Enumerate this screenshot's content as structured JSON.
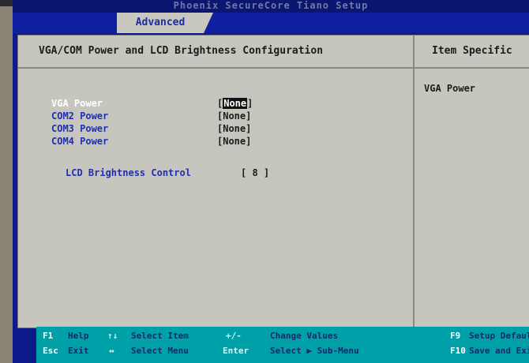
{
  "window": {
    "title": "Phoenix SecureCore Tiano Setup"
  },
  "tabs": [
    {
      "label": "Advanced"
    }
  ],
  "main": {
    "header": "VGA/COM Power and LCD Brightness Configuration",
    "items": [
      {
        "label": "VGA Power",
        "value_open": "[",
        "value": "None",
        "value_close": "]"
      },
      {
        "label": "COM2 Power",
        "value": "[None]"
      },
      {
        "label": "COM3 Power",
        "value": "[None]"
      },
      {
        "label": "COM4 Power",
        "value": "[None]"
      }
    ],
    "lcd": {
      "label": "LCD Brightness Control",
      "value": "[ 8 ]"
    }
  },
  "help_panel": {
    "header": "Item Specific",
    "text": "VGA Power"
  },
  "footer": {
    "row1": [
      {
        "key": "F1",
        "desc": "Help"
      },
      {
        "key": "↑↓",
        "desc": "Select Item"
      },
      {
        "key": "+/-",
        "desc": "Change Values"
      },
      {
        "key": "F9",
        "desc": "Setup Defaul"
      }
    ],
    "row2": [
      {
        "key": "Esc",
        "desc": "Exit"
      },
      {
        "key": "↔",
        "desc": "Select Menu"
      },
      {
        "key": "Enter",
        "desc": "Select ▶ Sub-Menu"
      },
      {
        "key": "F10",
        "desc": "Save and Exi"
      }
    ]
  },
  "colors": {
    "background": "#0d1a8a",
    "panel": "#c7c6be",
    "item_label": "#1f2fb0",
    "footer": "#00a0a8"
  }
}
